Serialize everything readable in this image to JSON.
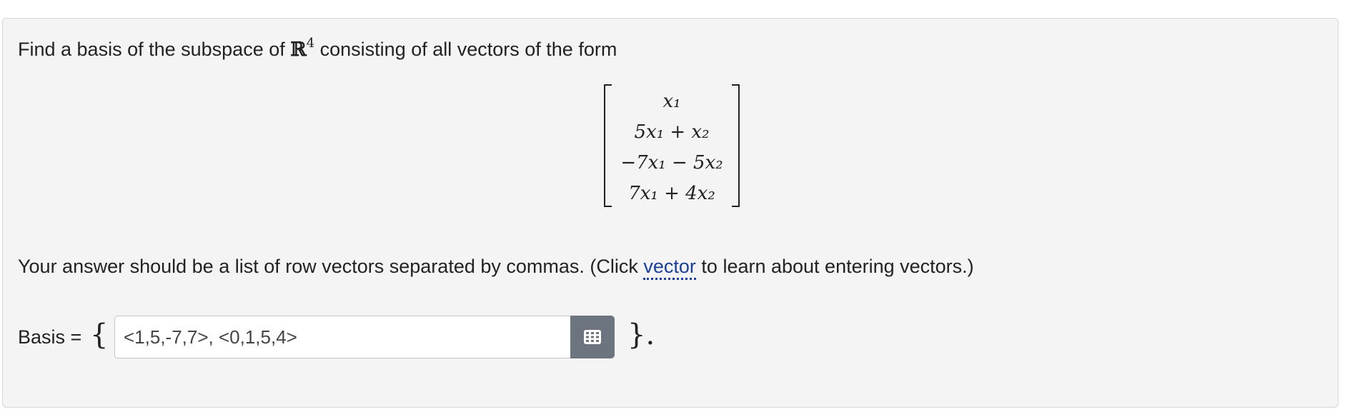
{
  "question": {
    "text_before": "Find a basis of the subspace of ",
    "space_symbol": "ℝ",
    "space_power": "4",
    "text_after": " consisting of all vectors of the form"
  },
  "matrix": {
    "rows": [
      "x₁",
      "5x₁ + x₂",
      "−7x₁ − 5x₂",
      "7x₁ + 4x₂"
    ]
  },
  "instructions": {
    "before_link": "Your answer should be a list of row vectors separated by commas. (Click ",
    "link_text": "vector",
    "after_link": " to learn about entering vectors.)"
  },
  "answer": {
    "label": "Basis = ",
    "open_brace": "{",
    "value": "<1,5,-7,7>, <0,1,5,4>",
    "close_brace": "}."
  },
  "icons": {
    "keyboard_button": "keyboard-icon"
  },
  "colors": {
    "panel_bg": "#f4f4f4",
    "link": "#1a3f9a",
    "button_bg": "#6c7480"
  }
}
